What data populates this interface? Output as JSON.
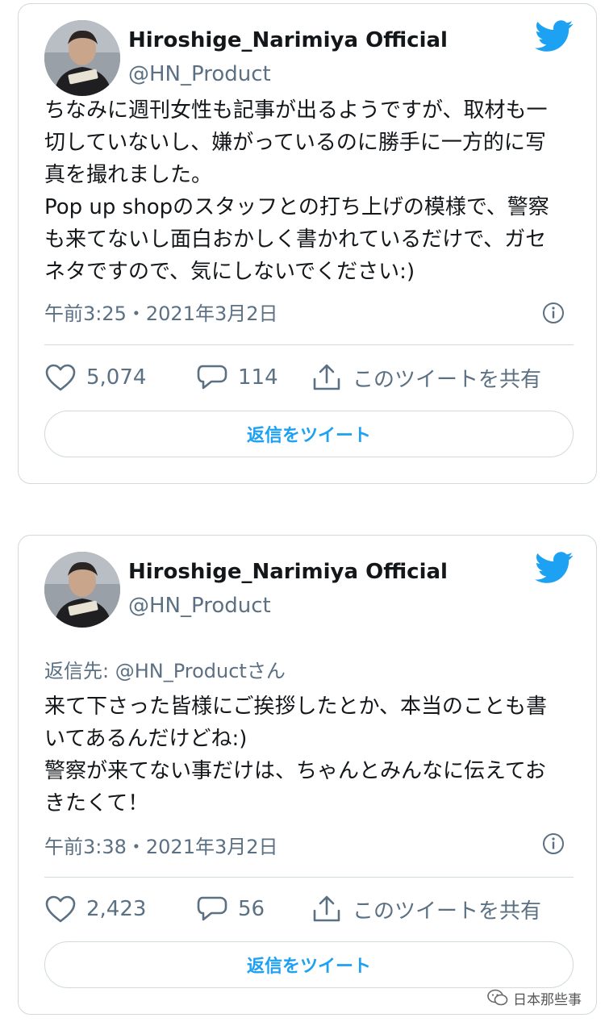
{
  "tweets": [
    {
      "display_name": "Hiroshige_Narimiya Official",
      "handle": "@HN_Product",
      "reply_to": "",
      "body_lines": [
        "ちなみに週刊女性も記事が出るようですが、取材も一",
        "切していないし、嫌がっているのに勝手に一方的に写",
        "真を撮れました。",
        "Pop up shopのスタッフとの打ち上げの模様で、警察",
        "も来てないし面白おかしく書かれているだけで、ガセ",
        "ネタですので、気にしないでください:)"
      ],
      "timestamp": "午前3:25・2021年3月2日",
      "likes": "5,074",
      "replies": "114",
      "share_label": "このツイートを共有",
      "reply_button_label": "返信をツイート"
    },
    {
      "display_name": "Hiroshige_Narimiya Official",
      "handle": "@HN_Product",
      "reply_to": "返信先: @HN_Productさん",
      "body_lines": [
        "来て下さった皆様にご挨拶したとか、本当のことも書",
        "いてあるんだけどね:)",
        "警察が来てない事だけは、ちゃんとみんなに伝えてお",
        "きたくて！"
      ],
      "timestamp": "午前3:38・2021年3月2日",
      "likes": "2,423",
      "replies": "56",
      "share_label": "このツイートを共有",
      "reply_button_label": "返信をツイート"
    }
  ],
  "watermark": "日本那些事",
  "icons": {
    "brand": "twitter-bird-icon",
    "info": "info-icon",
    "like": "heart-icon",
    "reply": "speech-bubble-icon",
    "share": "share-icon",
    "watermark": "wechat-icon"
  },
  "colors": {
    "brand_blue": "#1da1f2",
    "secondary_text": "#5b7083",
    "border": "#cfd9de"
  }
}
